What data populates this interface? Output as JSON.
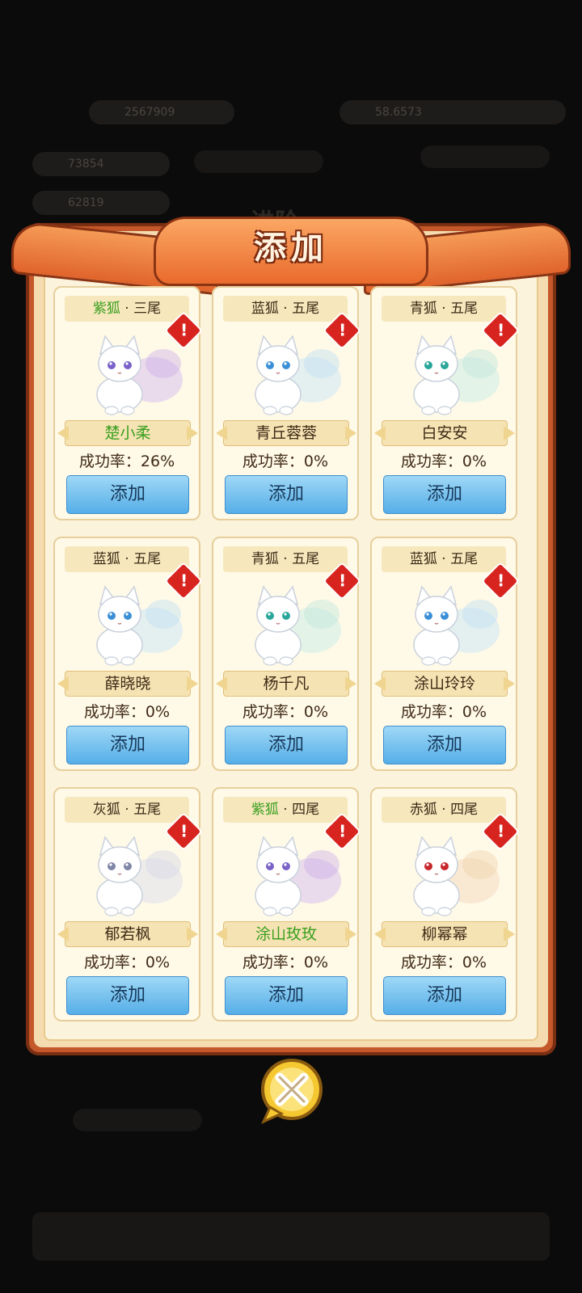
{
  "modal": {
    "title": "添加",
    "rate_label": "成功率：",
    "add_label": "添加"
  },
  "cards": [
    {
      "type": "紫狐",
      "tails": "· 三尾",
      "name": "楚小柔",
      "rate": "26%",
      "type_color": "#3aa020",
      "name_green": true,
      "fox": "purple-fox"
    },
    {
      "type": "蓝狐",
      "tails": "· 五尾",
      "name": "青丘蓉蓉",
      "rate": "0%",
      "type_color": "#3e2a15",
      "name_green": false,
      "fox": "blue-fox"
    },
    {
      "type": "青狐",
      "tails": "· 五尾",
      "name": "白安安",
      "rate": "0%",
      "type_color": "#3e2a15",
      "name_green": false,
      "fox": "teal-fox"
    },
    {
      "type": "蓝狐",
      "tails": "· 五尾",
      "name": "薛晓晓",
      "rate": "0%",
      "type_color": "#3e2a15",
      "name_green": false,
      "fox": "blue-fox"
    },
    {
      "type": "青狐",
      "tails": "· 五尾",
      "name": "杨千凡",
      "rate": "0%",
      "type_color": "#3e2a15",
      "name_green": false,
      "fox": "teal-fox"
    },
    {
      "type": "蓝狐",
      "tails": "· 五尾",
      "name": "涂山玲玲",
      "rate": "0%",
      "type_color": "#3e2a15",
      "name_green": false,
      "fox": "blue-fox"
    },
    {
      "type": "灰狐",
      "tails": "· 五尾",
      "name": "郁若枫",
      "rate": "0%",
      "type_color": "#3e2a15",
      "name_green": false,
      "fox": "gray-fox"
    },
    {
      "type": "紫狐",
      "tails": "· 四尾",
      "name": "涂山玫玫",
      "rate": "0%",
      "type_color": "#3aa020",
      "name_green": true,
      "fox": "purple-fox"
    },
    {
      "type": "赤狐",
      "tails": "· 四尾",
      "name": "柳幂幂",
      "rate": "0%",
      "type_color": "#3e2a15",
      "name_green": false,
      "fox": "red-fox"
    }
  ],
  "background": {
    "stat_values": [
      "2567909",
      "58.6573",
      "73854",
      "62819"
    ],
    "panel_title": "进阶"
  }
}
